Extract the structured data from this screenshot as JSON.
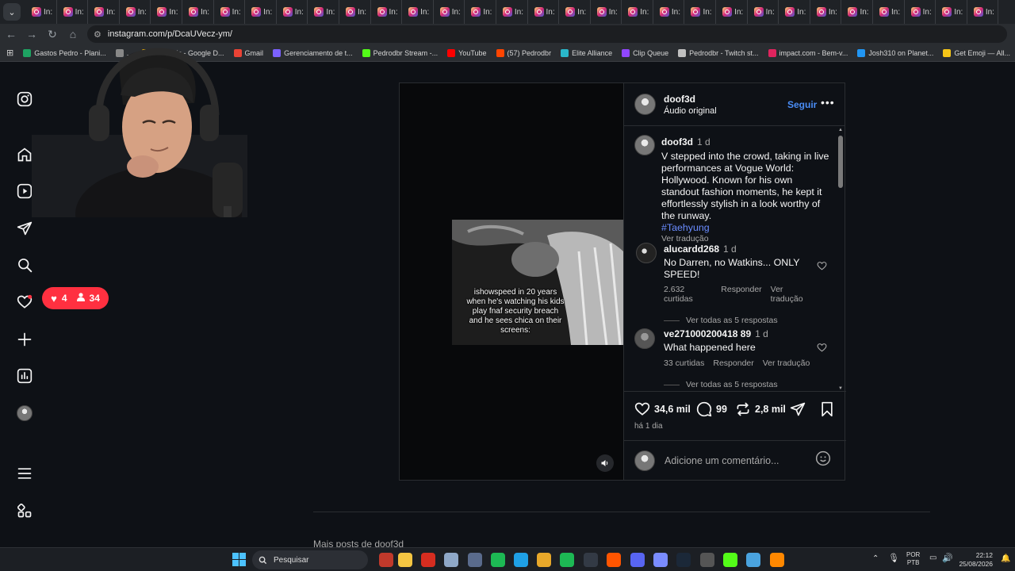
{
  "browser": {
    "tab_label": "In:",
    "tab_count": 31,
    "url": "instagram.com/p/DcaUVecz-ym/",
    "bookmarks": [
      {
        "label": "Gastos Pedro - Plani...",
        "color": "#1ea362"
      },
      {
        "label": "...",
        "color": "#888888"
      },
      {
        "label": "Render's - Google D...",
        "color": "#fbbc04"
      },
      {
        "label": "Gmail",
        "color": "#ea4335"
      },
      {
        "label": "Gerenciamento de t...",
        "color": "#7b61ff"
      },
      {
        "label": "Pedrodbr Stream -...",
        "color": "#53fc18"
      },
      {
        "label": "YouTube",
        "color": "#ff0000"
      },
      {
        "label": "(57) Pedrodbr",
        "color": "#ff4500"
      },
      {
        "label": "Elite Alliance",
        "color": "#2ab7ca"
      },
      {
        "label": "Clip Queue",
        "color": "#9146ff"
      },
      {
        "label": "Pedrodbr - Twitch st...",
        "color": "#c0c0c0"
      },
      {
        "label": "impact.com - Bem-v...",
        "color": "#e0245e"
      },
      {
        "label": "Josh310 on Planet...",
        "color": "#2196f3"
      },
      {
        "label": "Get Emoji — All...",
        "color": "#f5c518"
      }
    ]
  },
  "overlay": {
    "likes": "4",
    "followers": "34"
  },
  "post": {
    "author": "doof3d",
    "audio": "Áudio original",
    "follow_label": "Seguir",
    "video_caption": "ishowspeed in 20 years when he's watching his kids play fnaf security breach and he sees chica on their screens:",
    "caption": {
      "user": "doof3d",
      "time": "1 d",
      "text": "V stepped into the crowd, taking in live performances at Vogue World: Hollywood. Known for his own standout fashion moments, he kept it effortlessly stylish in a look worthy of the runway.",
      "hashtag": "#Taehyung",
      "translate": "Ver tradução"
    },
    "comments": [
      {
        "user": "alucardd268",
        "time": "1 d",
        "text": "No Darren, no Watkins... ONLY SPEED!",
        "likes": "2.632 curtidas",
        "reply": "Responder",
        "translate": "Ver tradução",
        "replies": "Ver todas as 5 respostas"
      },
      {
        "user": "ve271000200418 89",
        "time": "1 d",
        "text": "What happened here",
        "likes": "33 curtidas",
        "reply": "Responder",
        "translate": "Ver tradução",
        "replies": "Ver todas as 5 respostas"
      }
    ],
    "like_count": "34,6 mil",
    "comment_count": "99",
    "repost_count": "2,8 mil",
    "date": "há 1 dia",
    "comment_placeholder": "Adicione um comentário..."
  },
  "below_title": "Mais posts de doof3d",
  "taskbar": {
    "search_placeholder": "Pesquisar",
    "lang": "POR",
    "layout": "PTB",
    "time": "22:12",
    "date": "25/08/2026"
  }
}
